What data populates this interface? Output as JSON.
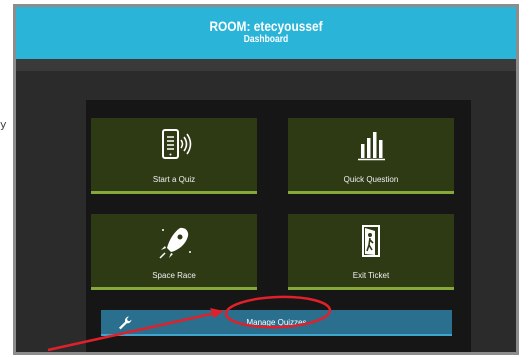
{
  "stray_text": "y",
  "header": {
    "room_title": "ROOM: etecyoussef",
    "subtitle": "Dashboard"
  },
  "tiles": [
    {
      "label": "Start a Quiz",
      "icon": "tablet-broadcast-icon"
    },
    {
      "label": "Quick Question",
      "icon": "bar-chart-icon"
    },
    {
      "label": "Space Race",
      "icon": "rocket-icon"
    },
    {
      "label": "Exit Ticket",
      "icon": "exit-door-icon"
    }
  ],
  "manage": {
    "label": "Manage Quizzes",
    "icon": "wrench-icon"
  },
  "annotation": {
    "color": "#e0202a",
    "shapes": [
      "red-arrow",
      "red-circle-highlight"
    ]
  },
  "colors": {
    "header": "#29b4d8",
    "tile": "#2e3a14",
    "tile_accent": "#86a83a",
    "manage_bar": "#2a6f8e"
  }
}
